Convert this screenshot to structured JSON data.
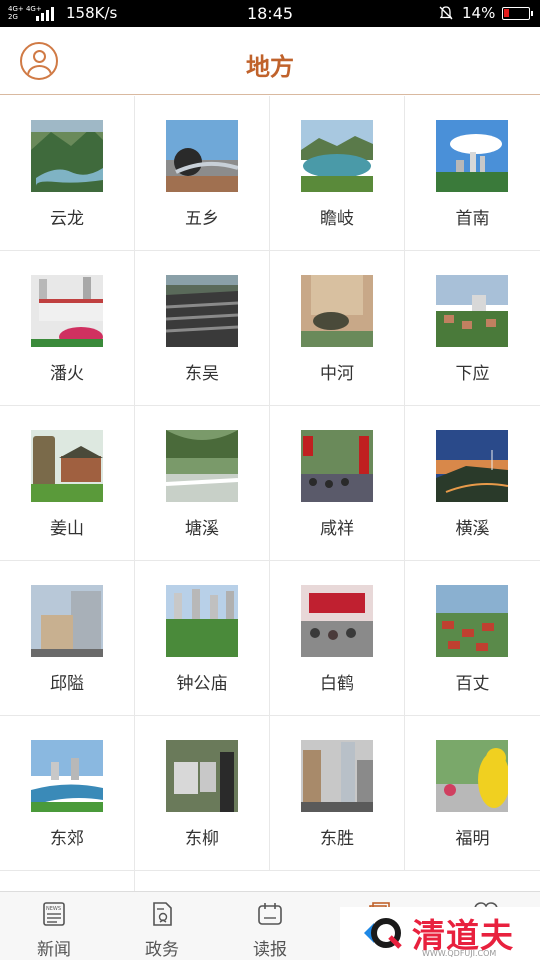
{
  "status_bar": {
    "network_top": "4G+ 4G+",
    "network_bottom": "2G",
    "speed": "158K/s",
    "time": "18:45",
    "battery": "14%"
  },
  "header": {
    "title": "地方",
    "accent_color": "#c0622b"
  },
  "places": [
    {
      "name": "云龙",
      "image": "mountain-valley-photo"
    },
    {
      "name": "五乡",
      "image": "bridge-dome-photo"
    },
    {
      "name": "瞻岐",
      "image": "lake-hills-photo"
    },
    {
      "name": "首南",
      "image": "city-skyline-photo"
    },
    {
      "name": "潘火",
      "image": "flower-buildings-photo"
    },
    {
      "name": "东吴",
      "image": "village-rooftops-photo"
    },
    {
      "name": "中河",
      "image": "bull-statue-photo"
    },
    {
      "name": "下应",
      "image": "residential-area-photo"
    },
    {
      "name": "姜山",
      "image": "stone-monument-photo"
    },
    {
      "name": "塘溪",
      "image": "stream-trees-photo"
    },
    {
      "name": "咸祥",
      "image": "festival-crowd-photo"
    },
    {
      "name": "横溪",
      "image": "wind-turbines-sunset-photo"
    },
    {
      "name": "邱隘",
      "image": "modern-buildings-photo"
    },
    {
      "name": "钟公庙",
      "image": "park-towers-photo"
    },
    {
      "name": "白鹤",
      "image": "stage-crowd-photo"
    },
    {
      "name": "百丈",
      "image": "red-roof-town-photo"
    },
    {
      "name": "东郊",
      "image": "river-city-photo"
    },
    {
      "name": "东柳",
      "image": "exhibition-photo"
    },
    {
      "name": "东胜",
      "image": "street-buildings-photo"
    },
    {
      "name": "福明",
      "image": "lion-dance-photo"
    }
  ],
  "bottom_nav": [
    {
      "label": "新闻",
      "icon": "newspaper-icon"
    },
    {
      "label": "政务",
      "icon": "document-badge-icon"
    },
    {
      "label": "读报",
      "icon": "reader-icon"
    },
    {
      "label": "",
      "icon": "layers-icon"
    },
    {
      "label": "",
      "icon": "heart-icon"
    }
  ],
  "watermark": {
    "text": "清道夫",
    "url": "WWW.QDFUJI.COM"
  }
}
